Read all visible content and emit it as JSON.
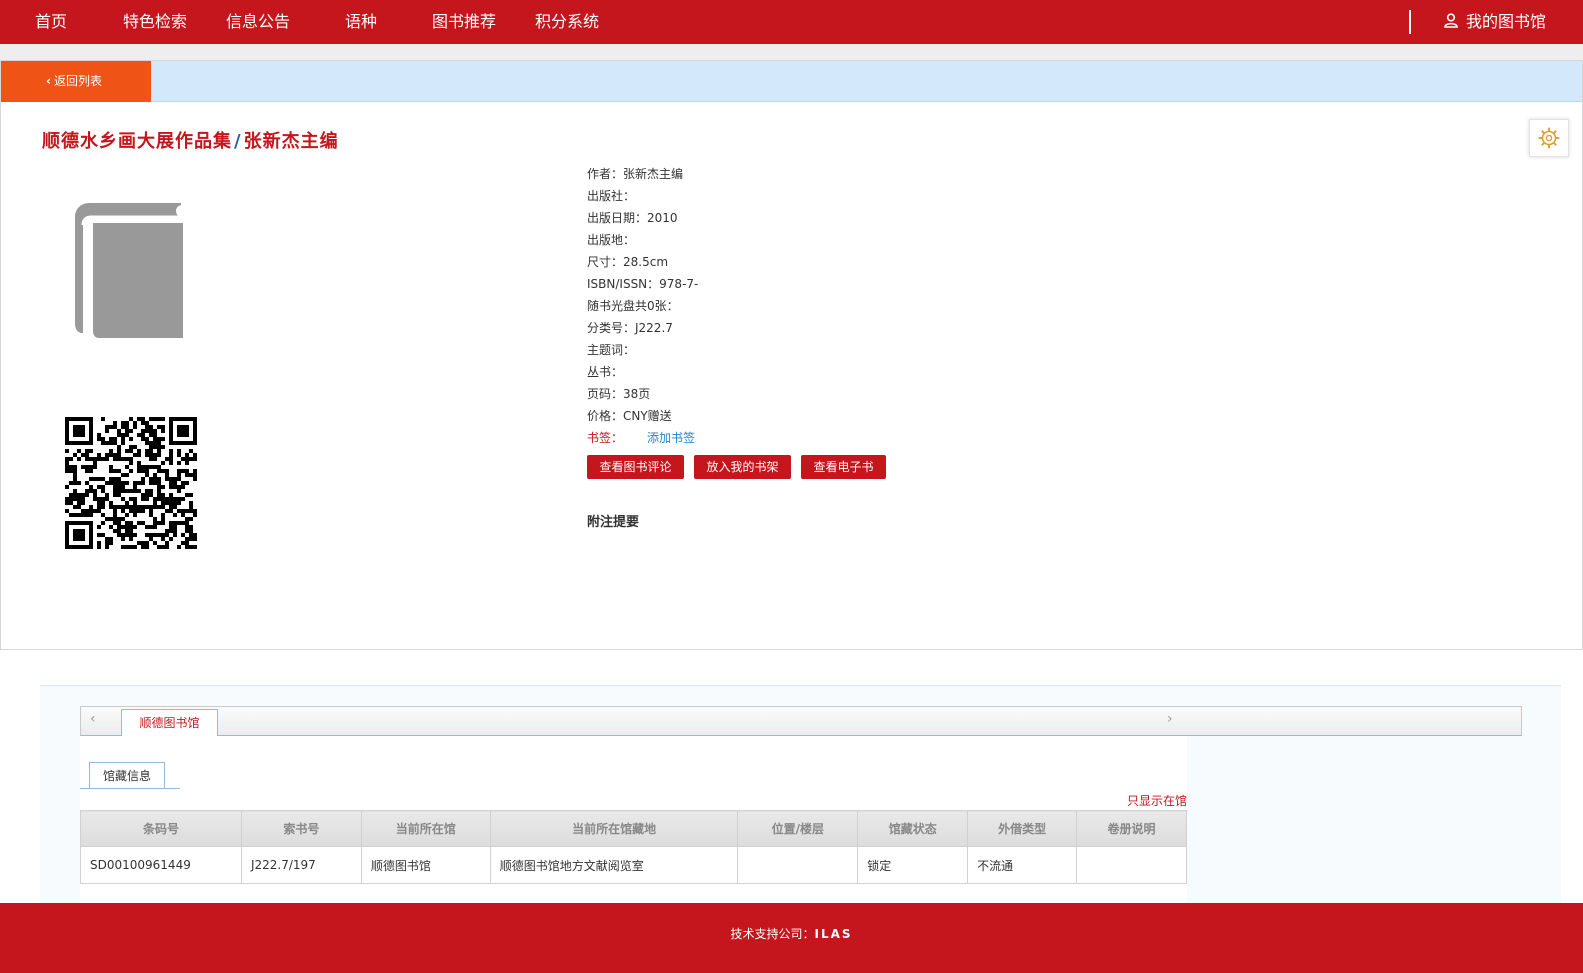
{
  "nav": {
    "items": [
      {
        "label": "首页"
      },
      {
        "label": "特色检索"
      },
      {
        "label": "信息公告"
      },
      {
        "label": "语种"
      },
      {
        "label": "图书推荐"
      },
      {
        "label": "积分系统"
      }
    ],
    "my_library": "我的图书馆",
    "my_library_icon": "user-icon"
  },
  "back_button": "返回列表",
  "book": {
    "title": "顺德水乡画大展作品集",
    "separator": "/",
    "responsibility": "张新杰主编"
  },
  "meta": [
    "作者：张新杰主编",
    "出版社：",
    "出版日期：2010",
    "出版地：",
    "尺寸：28.5cm",
    "ISBN/ISSN：978-7-",
    "随书光盘共0张：",
    "分类号：J222.7",
    "主题词：",
    "丛书：",
    "页码：38页",
    "价格：CNY赠送"
  ],
  "bookmark": {
    "label": "书签：",
    "link": "添加书签"
  },
  "buttons": {
    "reviews": "查看图书评论",
    "shelf": "放入我的书架",
    "ebook": "查看电子书"
  },
  "notes_title": "附注提要",
  "holdings": {
    "library_tab": "顺德图书馆",
    "sub_tab": "馆藏信息",
    "only_in_library": "只显示在馆",
    "headers": [
      "条码号",
      "索书号",
      "当前所在馆",
      "当前所在馆藏地",
      "位置/楼层",
      "馆藏状态",
      "外借类型",
      "卷册说明"
    ],
    "rows": [
      [
        "SD00100961449",
        "J222.7/197",
        "顺德图书馆",
        "顺德图书馆地方文献阅览室",
        "",
        "锁定",
        "不流通",
        ""
      ]
    ]
  },
  "footer": {
    "label": "技术支持公司：",
    "company": "ILAS"
  },
  "colors": {
    "brand_red": "#c4161c",
    "back_orange": "#ef5316",
    "light_blue": "#d3e8fb",
    "link_blue": "#1e86d0"
  }
}
